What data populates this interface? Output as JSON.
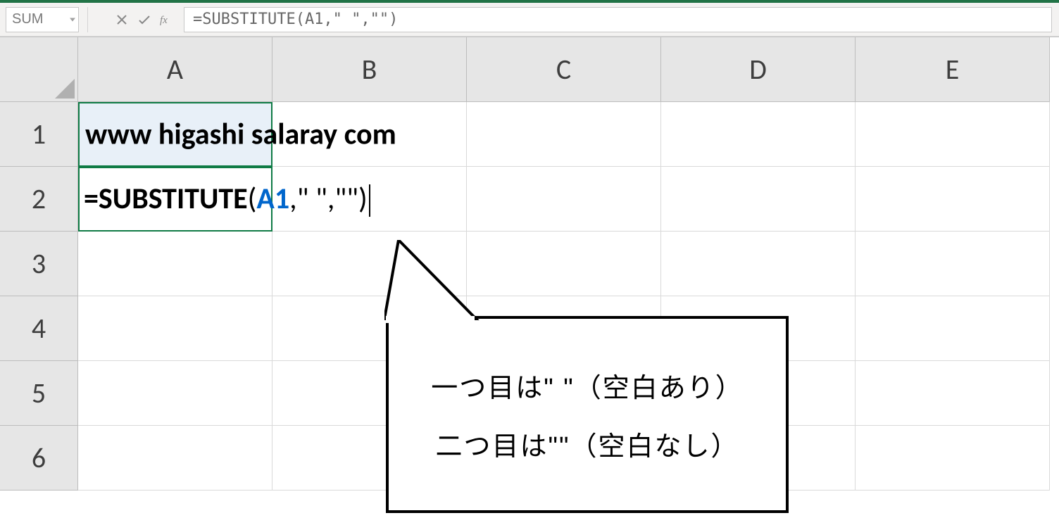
{
  "formula_bar": {
    "name_box": "SUM",
    "formula_text": "=SUBSTITUTE(A1,\" \",\"\")"
  },
  "columns": [
    "A",
    "B",
    "C",
    "D",
    "E"
  ],
  "rows": [
    "1",
    "2",
    "3",
    "4",
    "5",
    "6"
  ],
  "cells": {
    "A1": "www   higashi  salaray com",
    "A2_formula": {
      "eq": "=",
      "func": "SUBSTITUTE",
      "open": "(",
      "ref": "A1",
      "c1": ",",
      "str1": "\" \"",
      "c2": ",",
      "str2": "\"\"",
      "close": ")"
    }
  },
  "callout": {
    "line1": "一つ目は\" \"（空白あり）",
    "line2": "二つ目は\"\"（空白なし）"
  }
}
